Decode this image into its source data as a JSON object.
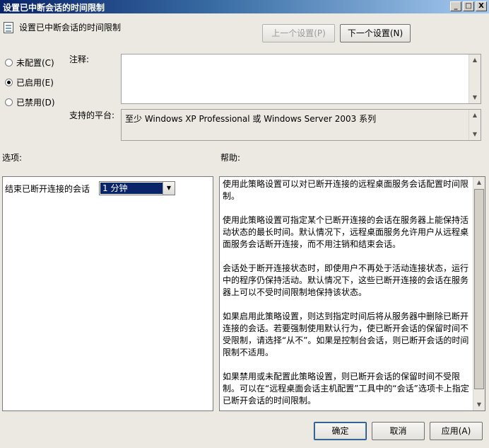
{
  "window": {
    "title": "设置已中断会话的时间限制",
    "min_glyph": "_",
    "max_glyph": "□",
    "close_glyph": "X"
  },
  "heading": "设置已中断会话的时间限制",
  "nav": {
    "prev": "上一个设置(P)",
    "next": "下一个设置(N)"
  },
  "state": {
    "options": [
      {
        "label": "未配置(C)",
        "checked": false
      },
      {
        "label": "已启用(E)",
        "checked": true
      },
      {
        "label": "已禁用(D)",
        "checked": false
      }
    ]
  },
  "comment": {
    "label": "注释:",
    "value": ""
  },
  "platform": {
    "label": "支持的平台:",
    "value": "至少 Windows XP Professional 或 Windows Server 2003 系列"
  },
  "options_section": {
    "label": "选项:",
    "setting_label": "结束已断开连接的会话",
    "setting_value": "1 分钟"
  },
  "help_section": {
    "label": "帮助:",
    "paragraphs": [
      "使用此策略设置可以对已断开连接的远程桌面服务会话配置时间限制。",
      "使用此策略设置可指定某个已断开连接的会话在服务器上能保持活动状态的最长时间。默认情况下，远程桌面服务允许用户从远程桌面服务会话断开连接，而不用注销和结束会话。",
      "会话处于断开连接状态时，即使用户不再处于活动连接状态，运行中的程序仍保持活动。默认情况下，这些已断开连接的会话在服务器上可以不受时间限制地保持该状态。",
      "如果启用此策略设置，则达到指定时间后将从服务器中删除已断开连接的会话。若要强制使用默认行为，使已断开会话的保留时间不受限制，请选择“从不”。如果是控制台会话，则已断开会话的时间限制不适用。",
      "如果禁用或未配置此策略设置，则已断开会话的保留时间不受限制。可以在“远程桌面会话主机配置”工具中的“会话”选项卡上指定已断开会话的时间限制。"
    ]
  },
  "buttons": {
    "ok": "确定",
    "cancel": "取消",
    "apply": "应用(A)"
  },
  "icons": {
    "scroll_up": "▲",
    "scroll_down": "▼",
    "dropdown": "▼"
  },
  "colors": {
    "title_start": "#0a246a",
    "title_end": "#a6caf0",
    "selection": "#0a246a",
    "dialog_bg": "#ece9e2"
  }
}
